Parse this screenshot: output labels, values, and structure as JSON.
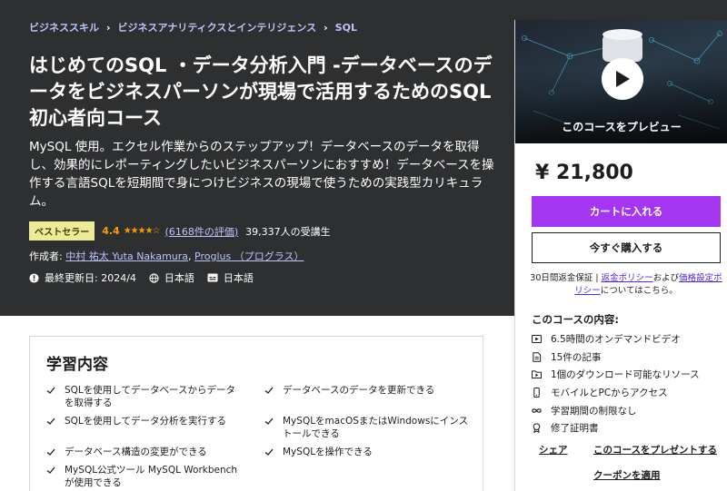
{
  "breadcrumb": [
    "ビジネススキル",
    "ビジネスアナリティクスとインテリジェンス",
    "SQL"
  ],
  "course": {
    "title": "はじめてのSQL ・データ分析入門 -データベースのデータをビジネスパーソンが現場で活用するためのSQL初心者向コース",
    "subtitle": "MySQL 使用。エクセル作業からのステップアップ！データベースのデータを取得し、効果的にレポーティングしたいビジネスパーソンにおすすめ！データベースを操作する言語SQLを短期間で身につけビジネスの現場で使うための実践型カリキュラム。",
    "badge": "ベストセラー",
    "rating": "4.4",
    "stars": 4.4,
    "ratings_count": "(6168件の評価)",
    "students": "39,337人の受講生",
    "author_prefix": "作成者:",
    "authors": [
      "中村 祐太 Yuta Nakamura",
      "Proglus （プログラス）"
    ],
    "author_sep": ", ",
    "updated": "最終更新日: 2024/4",
    "language": "日本語",
    "captions": "日本語"
  },
  "sidebar": {
    "preview_label": "このコースをプレビュー",
    "price": "¥ 21,800",
    "cart_button": "カートに入れる",
    "buy_button": "今すぐ購入する",
    "refund_text": "30日間返金保証 | ",
    "refund_policy": "返金ポリシー",
    "refund_and": "および",
    "price_policy": "価格設定ポリシー",
    "refund_tail": "についてはこちら。",
    "includes_title": "このコースの内容:",
    "includes": [
      {
        "icon": "video-icon",
        "text": "6.5時間のオンデマンドビデオ"
      },
      {
        "icon": "article-icon",
        "text": "15件の記事"
      },
      {
        "icon": "folder-icon",
        "text": "1個のダウンロード可能なリソース"
      },
      {
        "icon": "mobile-icon",
        "text": "モバイルとPCからアクセス"
      },
      {
        "icon": "infinity-icon",
        "text": "学習期間の制限なし"
      },
      {
        "icon": "certificate-icon",
        "text": "修了証明書"
      }
    ],
    "share": "シェア",
    "gift": "このコースをプレゼントする",
    "coupon": "クーポンを適用"
  },
  "learn": {
    "title": "学習内容",
    "items": [
      "SQLを使用してデータベースからデータを取得する",
      "データベースのデータを更新できる",
      "SQLを使用してデータ分析を実行する",
      "MySQLをmacOSまたはWindowsにインストールできる",
      "データベース構造の変更ができる",
      "MySQLを操作できる",
      "MySQL公式ツール MySQL Workbenchが使用できる"
    ]
  },
  "colors": {
    "hero_bg": "#2d2f31",
    "accent_purple": "#a435f0",
    "link_lavender": "#c0c4fc",
    "star_orange": "#f69c08",
    "badge_yellow": "#eceb98"
  }
}
